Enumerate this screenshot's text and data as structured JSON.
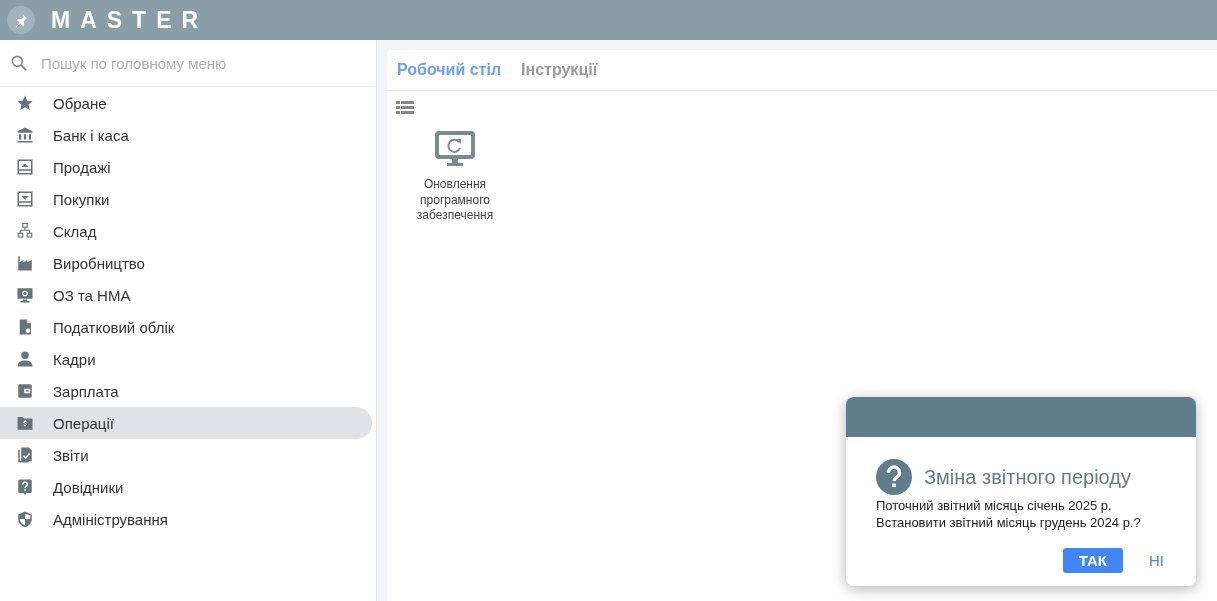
{
  "app": {
    "logo_text": "MASTER"
  },
  "sidebar": {
    "search": {
      "placeholder": "Пошук по головному меню"
    },
    "items": [
      {
        "label": "Обране",
        "selected": false
      },
      {
        "label": "Банк і каса",
        "selected": false
      },
      {
        "label": "Продажі",
        "selected": false
      },
      {
        "label": "Покупки",
        "selected": false
      },
      {
        "label": "Склад",
        "selected": false
      },
      {
        "label": "Виробництво",
        "selected": false
      },
      {
        "label": "ОЗ та НМА",
        "selected": false
      },
      {
        "label": "Податковий облік",
        "selected": false
      },
      {
        "label": "Кадри",
        "selected": false
      },
      {
        "label": "Зарплата",
        "selected": false
      },
      {
        "label": "Операції",
        "selected": true
      },
      {
        "label": "Звіти",
        "selected": false
      },
      {
        "label": "Довідники",
        "selected": false
      },
      {
        "label": "Адміністрування",
        "selected": false
      }
    ]
  },
  "tabs": [
    {
      "label": "Робочий стіл",
      "selected": true
    },
    {
      "label": "Інструкції",
      "selected": false
    }
  ],
  "desktop": {
    "tiles": [
      {
        "label": "Оновлення програмного забезпечення"
      }
    ]
  },
  "dialog": {
    "title": "Зміна звітного періоду",
    "lines": [
      "Поточний звітний місяць січень 2025 р.",
      "Встановити звітний місяць грудень 2024 р.?"
    ],
    "buttons": [
      {
        "label": "ТАК",
        "kind": "primary"
      },
      {
        "label": "НІ",
        "kind": "flat"
      }
    ]
  }
}
